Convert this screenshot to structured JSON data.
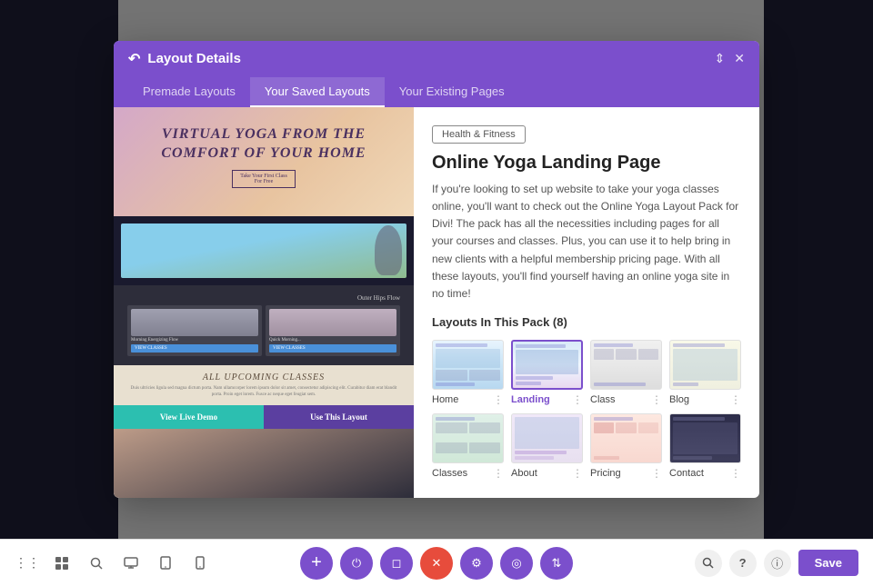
{
  "modal": {
    "title": "Layout Details",
    "tabs": [
      {
        "id": "premade",
        "label": "Premade Layouts"
      },
      {
        "id": "saved",
        "label": "Your Saved Layouts"
      },
      {
        "id": "existing",
        "label": "Your Existing Pages"
      }
    ],
    "active_tab": "saved"
  },
  "layout": {
    "category": "Health & Fitness",
    "title": "Online Yoga Landing Page",
    "description": "If you're looking to set up website to take your yoga classes online, you'll want to check out the Online Yoga Layout Pack for Divi! The pack has all the necessities including pages for all your courses and classes. Plus, you can use it to help bring in new clients with a helpful membership pricing page. With all these layouts, you'll find yourself having an online yoga site in no time!",
    "pack_label": "Layouts In This Pack (8)",
    "items": [
      {
        "id": "home",
        "name": "Home",
        "selected": false
      },
      {
        "id": "landing",
        "name": "Landing",
        "selected": true
      },
      {
        "id": "class",
        "name": "Class",
        "selected": false
      },
      {
        "id": "blog",
        "name": "Blog",
        "selected": false
      },
      {
        "id": "classes",
        "name": "Classes",
        "selected": false
      },
      {
        "id": "about",
        "name": "About",
        "selected": false
      },
      {
        "id": "pricing",
        "name": "Pricing",
        "selected": false
      },
      {
        "id": "contact",
        "name": "Contact",
        "selected": false
      }
    ],
    "preview": {
      "hero_title": "Virtual Yoga from the Comfort of Your Home",
      "hero_btn": "Take Your First Class For Free",
      "section_outer_hips": "Outer Hips Flow",
      "section_morning": "Morning Energizing Flow",
      "classes_title": "All Upcoming Classes",
      "btn_demo": "View Live Demo",
      "btn_use": "Use This Layout"
    }
  },
  "toolbar": {
    "left_icons": [
      "grid-icon",
      "layout-icon",
      "search-icon",
      "monitor-icon",
      "tablet-icon",
      "mobile-icon"
    ],
    "center_buttons": [
      {
        "id": "add",
        "icon": "+",
        "color": "purple"
      },
      {
        "id": "power",
        "icon": "⏻",
        "color": "purple"
      },
      {
        "id": "delete",
        "icon": "⊡",
        "color": "purple"
      },
      {
        "id": "close",
        "icon": "✕",
        "color": "red"
      },
      {
        "id": "settings",
        "icon": "⚙",
        "color": "purple"
      },
      {
        "id": "history",
        "icon": "◎",
        "color": "purple"
      },
      {
        "id": "adjust",
        "icon": "⇅",
        "color": "purple"
      }
    ],
    "right_icons": [
      "search-icon",
      "help-icon",
      "info-icon"
    ],
    "save_label": "Save"
  }
}
